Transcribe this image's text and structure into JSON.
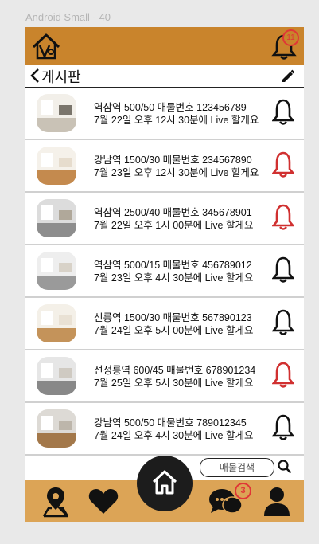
{
  "frame_label": "Android Small - 40",
  "header": {
    "notification_count": "11"
  },
  "titlebar": {
    "title": "게시판"
  },
  "listings": [
    {
      "line1": "역삼역 500/50 매물번호 123456789",
      "line2": "7월 22일 오후 12시 30분에 Live 할게요",
      "alert_on": false
    },
    {
      "line1": "강남역 1500/30 매물번호 234567890",
      "line2": "7월 23일 오후 12시 30분에 Live 할게요",
      "alert_on": true
    },
    {
      "line1": "역삼역 2500/40 매물번호 345678901",
      "line2": "7월 22일 오후 1시 00분에 Live 할게요",
      "alert_on": true
    },
    {
      "line1": "역삼역 5000/15 매물번호 456789012",
      "line2": "7월 23일 오후 4시 30분에 Live 할게요",
      "alert_on": false
    },
    {
      "line1": "선릉역 1500/30 매물번호 567890123",
      "line2": "7월 24일 오후 5시 00분에 Live 할게요",
      "alert_on": false
    },
    {
      "line1": "선정릉역 600/45 매물번호 678901234",
      "line2": "7월 25일 오후 5시 30분에 Live 할게요",
      "alert_on": true
    },
    {
      "line1": "강남역 500/50 매물번호 789012345",
      "line2": "7월 24일 오후 4시 30분에 Live 할게요",
      "alert_on": false
    }
  ],
  "search": {
    "placeholder": "매물검색"
  },
  "bottom_nav": {
    "chat_badge": "3"
  },
  "colors": {
    "header": "#c9842c",
    "bottom": "#dca456",
    "alert_red": "#d03030",
    "dark": "#111111"
  }
}
